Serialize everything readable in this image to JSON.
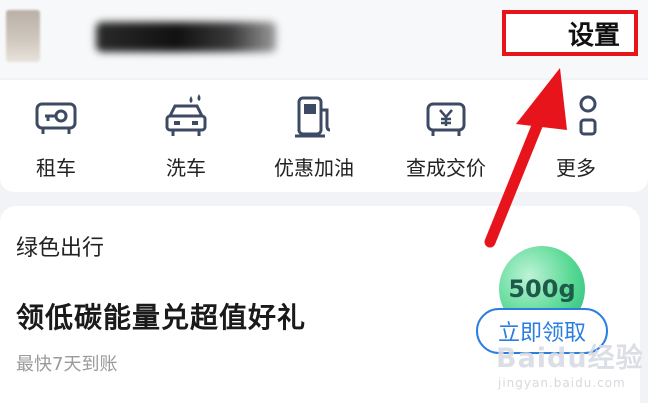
{
  "header": {
    "settings_label": "设置"
  },
  "quick_actions": [
    {
      "label": "租车",
      "icon": "car-key-icon"
    },
    {
      "label": "洗车",
      "icon": "car-wash-icon"
    },
    {
      "label": "优惠加油",
      "icon": "fuel-pump-icon"
    },
    {
      "label": "查成交价",
      "icon": "price-tag-yen-icon"
    },
    {
      "label": "更多",
      "icon": "more-grid-icon"
    }
  ],
  "promo_card": {
    "title": "绿色出行",
    "headline": "领低碳能量兑超值好礼",
    "subtext": "最快7天到账",
    "energy_badge": "500g",
    "claim_button": "立即领取"
  },
  "annotation": {
    "highlight_color": "#e8141b",
    "arrow_color": "#e8141b"
  },
  "watermark": {
    "logo": "Baidu经验",
    "url": "jingyan.baidu.com"
  }
}
